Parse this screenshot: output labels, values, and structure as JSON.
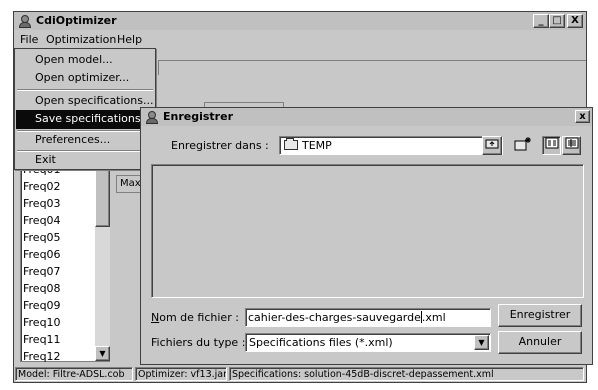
{
  "main_window": {
    "title": "CdiOptimizer",
    "controls": {
      "minimize": "_",
      "maximize": "□",
      "close": "X"
    }
  },
  "menubar": {
    "items": [
      "File",
      "Optimization",
      "Help"
    ]
  },
  "file_menu": {
    "items": [
      {
        "label": "Open model...",
        "active": false
      },
      {
        "label": "Open optimizer...",
        "active": false
      },
      {
        "label": "Open specifications...",
        "active": false
      },
      {
        "label": "Save specifications...",
        "active": true
      },
      {
        "label": "Preferences...",
        "active": false
      },
      {
        "label": "Exit",
        "active": false
      }
    ]
  },
  "freq_list": {
    "items": [
      "Freq01",
      "Freq02",
      "Freq03",
      "Freq04",
      "Freq05",
      "Freq06",
      "Freq07",
      "Freq08",
      "Freq09",
      "Freq10",
      "Freq11",
      "Freq12"
    ]
  },
  "max_label": "Max",
  "status_bar": {
    "model": "Model: Filtre-ADSL.cob",
    "optimizer": "Optimizer: vf13.jar",
    "specifications": "Specifications: solution-45dB-discret-depassement.xml"
  },
  "dialog": {
    "title": "Enregistrer",
    "close": "x",
    "save_in_label": "Enregistrer dans :",
    "save_in_value": "TEMP",
    "filename_label": "Nom de fichier :",
    "filename_before_caret": "cahier-des-charges-sauvegarde",
    "filename_after_caret": "xml",
    "filetype_label": "Fichiers du type :",
    "filetype_value": "Specifications files (*.xml)",
    "save_button": "Enregistrer",
    "cancel_button": "Annuler",
    "icons": [
      "up-folder-icon",
      "new-folder-icon",
      "list-view-icon",
      "details-view-icon"
    ]
  },
  "colors": {
    "menu_highlight": "#0a0a0a",
    "face": "#c8c8c8"
  }
}
